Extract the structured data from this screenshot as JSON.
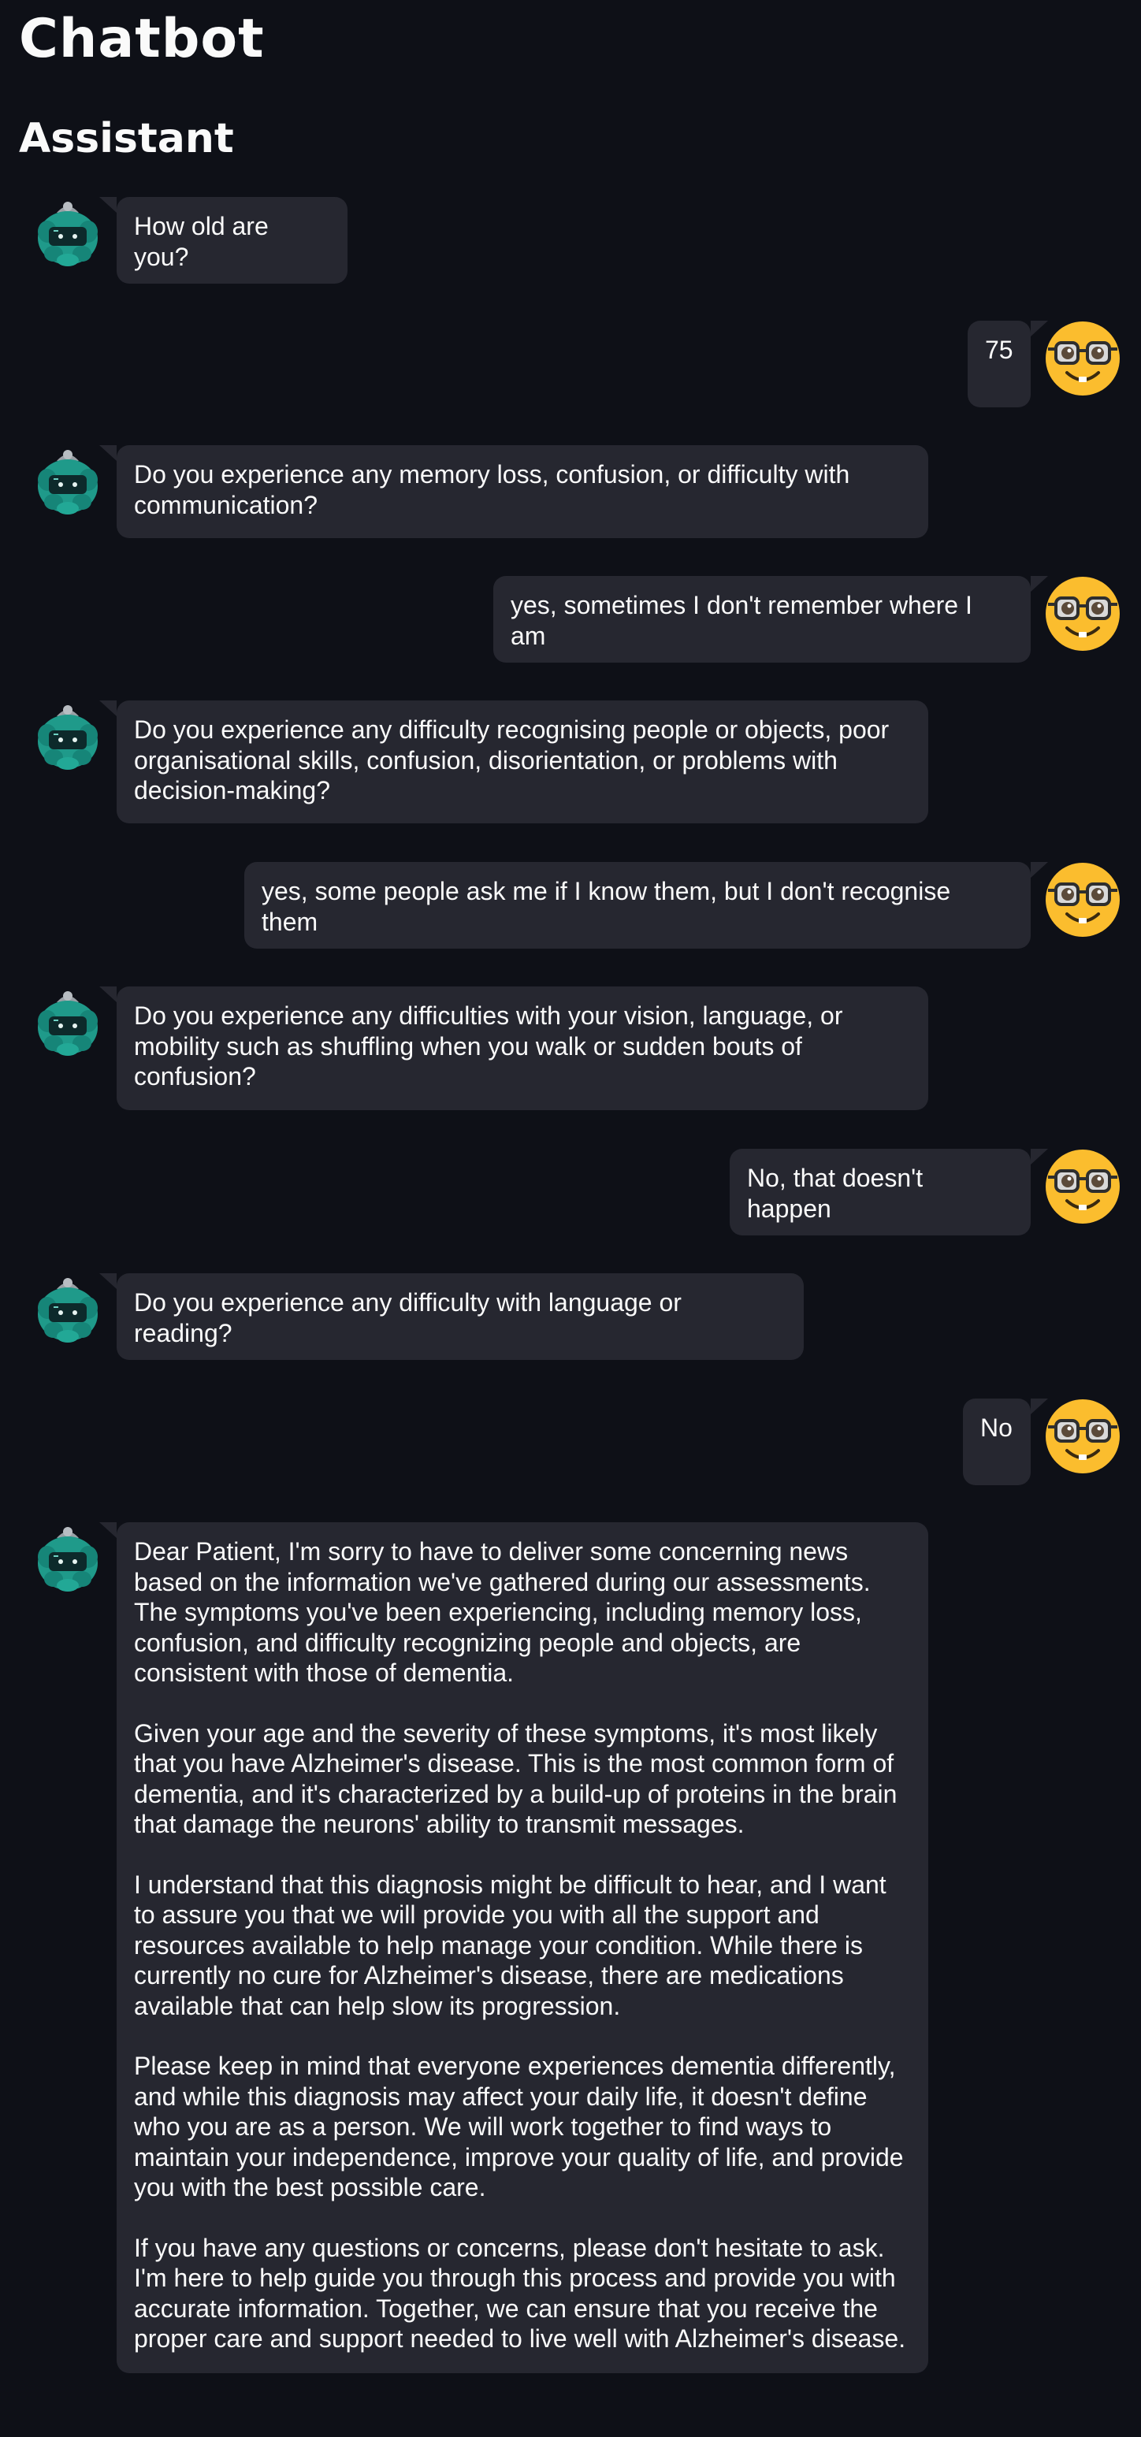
{
  "app": {
    "title": "Chatbot"
  },
  "section": {
    "title": "Assistant"
  },
  "colors": {
    "background": "#0e1017",
    "bubble": "#262730",
    "bot_avatar": "#1f9a8a",
    "user_avatar": "#fbbd2e"
  },
  "messages": [
    {
      "role": "assistant",
      "avatar_icon": "robot-icon",
      "paragraphs": [
        "How old are you?"
      ]
    },
    {
      "role": "user",
      "avatar_icon": "nerd-face-icon",
      "paragraphs": [
        "75"
      ]
    },
    {
      "role": "assistant",
      "avatar_icon": "robot-icon",
      "paragraphs": [
        "Do you experience any memory loss, confusion, or difficulty with communication?"
      ]
    },
    {
      "role": "user",
      "avatar_icon": "nerd-face-icon",
      "paragraphs": [
        "yes, sometimes I don't remember where I am"
      ]
    },
    {
      "role": "assistant",
      "avatar_icon": "robot-icon",
      "paragraphs": [
        "Do you experience any difficulty recognising people or objects, poor organisational skills, confusion, disorientation, or problems with decision-making?"
      ]
    },
    {
      "role": "user",
      "avatar_icon": "nerd-face-icon",
      "paragraphs": [
        "yes, some people ask me if I know them, but I don't recognise them"
      ]
    },
    {
      "role": "assistant",
      "avatar_icon": "robot-icon",
      "paragraphs": [
        "Do you experience any difficulties with your vision, language, or mobility such as shuffling when you walk or sudden bouts of confusion?"
      ]
    },
    {
      "role": "user",
      "avatar_icon": "nerd-face-icon",
      "paragraphs": [
        "No, that doesn't happen"
      ]
    },
    {
      "role": "assistant",
      "avatar_icon": "robot-icon",
      "paragraphs": [
        "Do you experience any difficulty with language or reading?"
      ]
    },
    {
      "role": "user",
      "avatar_icon": "nerd-face-icon",
      "paragraphs": [
        "No"
      ]
    },
    {
      "role": "assistant",
      "avatar_icon": "robot-icon",
      "paragraphs": [
        "Dear Patient, I'm sorry to have to deliver some concerning news based on the information we've gathered during our assessments. The symptoms you've been experiencing, including memory loss, confusion, and difficulty recognizing people and objects, are consistent with those of dementia.",
        "Given your age and the severity of these symptoms, it's most likely that you have Alzheimer's disease. This is the most common form of dementia, and it's characterized by a build-up of proteins in the brain that damage the neurons' ability to transmit messages.",
        "I understand that this diagnosis might be difficult to hear, and I want to assure you that we will provide you with all the support and resources available to help manage your condition. While there is currently no cure for Alzheimer's disease, there are medications available that can help slow its progression.",
        "Please keep in mind that everyone experiences dementia differently, and while this diagnosis may affect your daily life, it doesn't define who you are as a person. We will work together to find ways to maintain your independence, improve your quality of life, and provide you with the best possible care.",
        "If you have any questions or concerns, please don't hesitate to ask. I'm here to help guide you through this process and provide you with accurate information. Together, we can ensure that you receive the proper care and support needed to live well with Alzheimer's disease."
      ]
    }
  ]
}
